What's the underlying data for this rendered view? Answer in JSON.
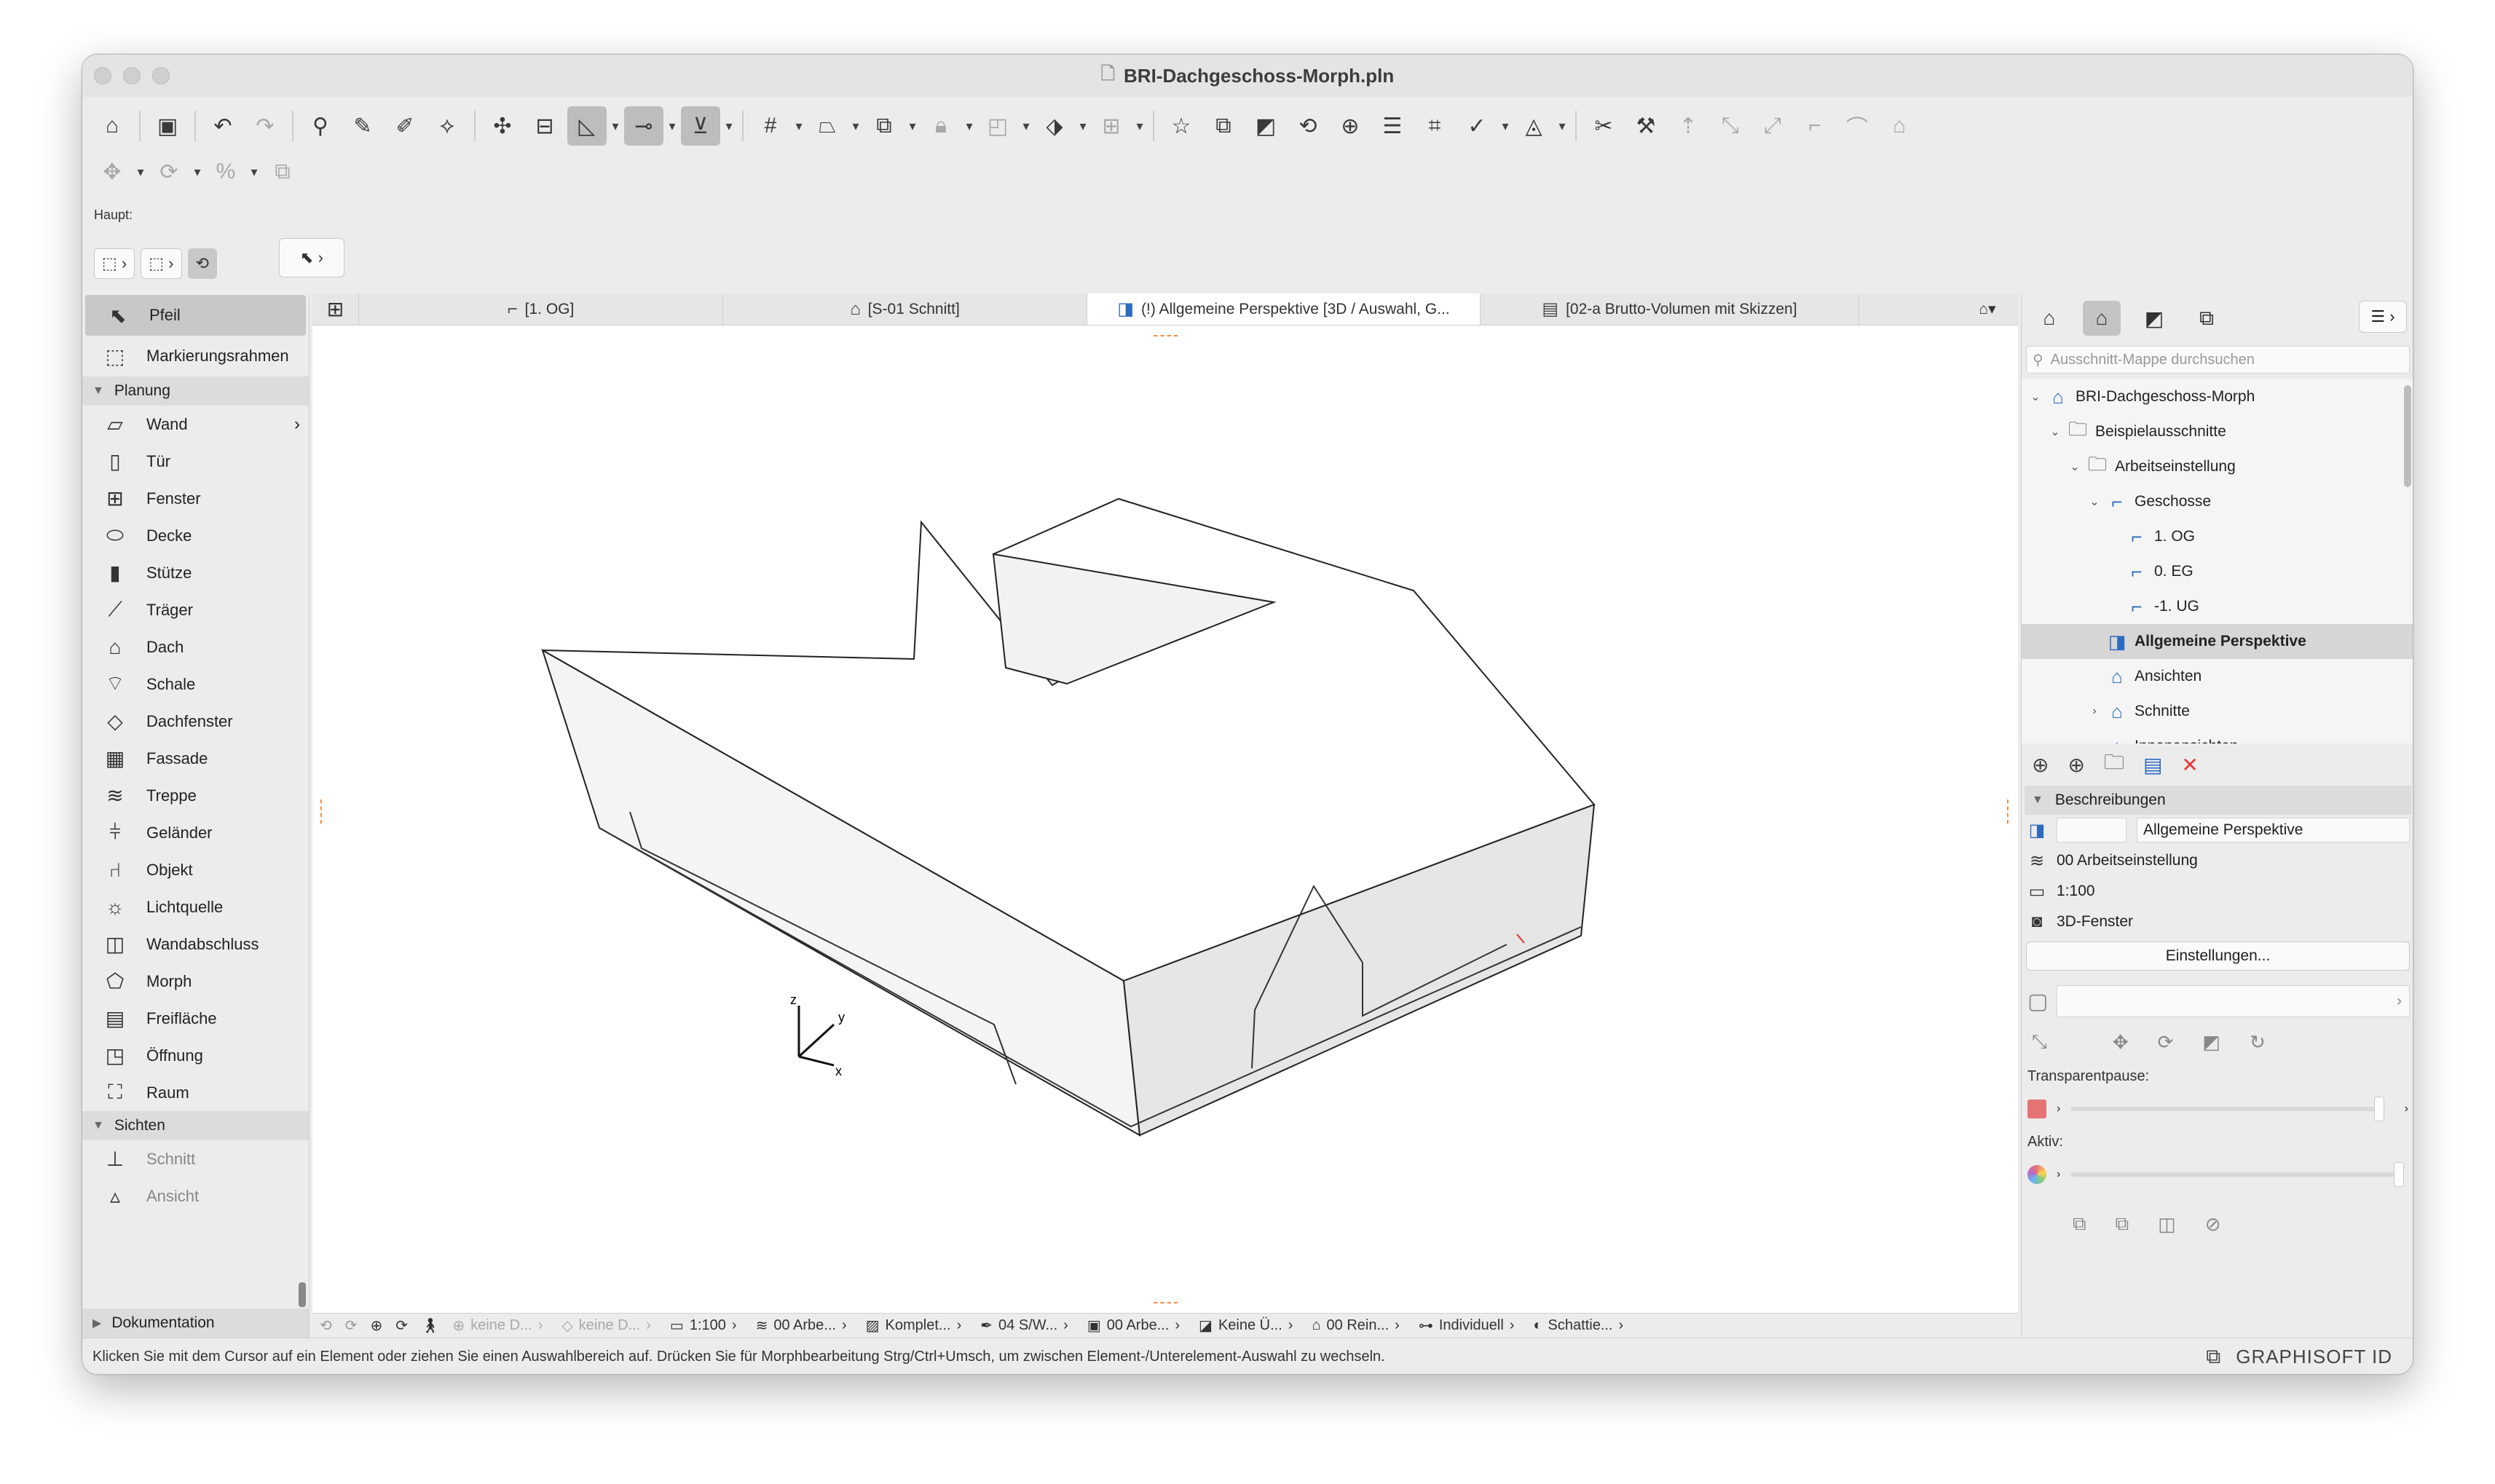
{
  "window": {
    "title": "BRI-Dachgeschoss-Morph.pln"
  },
  "toolbar": {
    "haupt_label": "Haupt:"
  },
  "toolbox": {
    "items_top": [
      {
        "label": "Pfeil",
        "icon": "arrow-pointer-icon",
        "glyph": "⬉",
        "active": true
      },
      {
        "label": "Markierungsrahmen",
        "icon": "marquee-icon",
        "glyph": "⬚"
      }
    ],
    "section_planung": "Planung",
    "planung_items": [
      {
        "label": "Wand",
        "icon": "wall-icon",
        "glyph": "▱",
        "arrow": true
      },
      {
        "label": "Tür",
        "icon": "door-icon",
        "glyph": "▯"
      },
      {
        "label": "Fenster",
        "icon": "window-icon",
        "glyph": "⊞"
      },
      {
        "label": "Decke",
        "icon": "slab-icon",
        "glyph": "⬭"
      },
      {
        "label": "Stütze",
        "icon": "column-icon",
        "glyph": "▮"
      },
      {
        "label": "Träger",
        "icon": "beam-icon",
        "glyph": "⟋"
      },
      {
        "label": "Dach",
        "icon": "roof-icon",
        "glyph": "⌂"
      },
      {
        "label": "Schale",
        "icon": "shell-icon",
        "glyph": "⌔"
      },
      {
        "label": "Dachfenster",
        "icon": "skylight-icon",
        "glyph": "◇"
      },
      {
        "label": "Fassade",
        "icon": "curtain-wall-icon",
        "glyph": "▦"
      },
      {
        "label": "Treppe",
        "icon": "stair-icon",
        "glyph": "≋"
      },
      {
        "label": "Geländer",
        "icon": "railing-icon",
        "glyph": "⫩"
      },
      {
        "label": "Objekt",
        "icon": "object-chair-icon",
        "glyph": "⑁"
      },
      {
        "label": "Lichtquelle",
        "icon": "lamp-icon",
        "glyph": "☼"
      },
      {
        "label": "Wandabschluss",
        "icon": "wall-end-icon",
        "glyph": "◫"
      },
      {
        "label": "Morph",
        "icon": "morph-icon",
        "glyph": "⬠"
      },
      {
        "label": "Freifläche",
        "icon": "mesh-icon",
        "glyph": "▤"
      },
      {
        "label": "Öffnung",
        "icon": "opening-icon",
        "glyph": "◳"
      },
      {
        "label": "Raum",
        "icon": "zone-icon",
        "glyph": "⛶"
      }
    ],
    "section_sichten": "Sichten",
    "sichten_items": [
      {
        "label": "Schnitt",
        "icon": "section-icon",
        "glyph": "⊥"
      },
      {
        "label": "Ansicht",
        "icon": "elevation-icon",
        "glyph": "▵"
      }
    ],
    "section_dokumentation": "Dokumentation"
  },
  "tabs": [
    {
      "label": "[1. OG]",
      "icon": "floor-plan-icon",
      "glyph": "⌐"
    },
    {
      "label": "[S-01 Schnitt]",
      "icon": "section-tab-icon",
      "glyph": "⌂"
    },
    {
      "label": "(!) Allgemeine Perspektive [3D / Auswahl, G...",
      "icon": "3d-view-icon",
      "glyph": "◨",
      "active": true
    },
    {
      "label": "[02-a Brutto-Volumen mit Skizzen]",
      "icon": "worksheet-icon",
      "glyph": "▤"
    }
  ],
  "navigator": {
    "search_placeholder": "Ausschnitt-Mappe durchsuchen",
    "tree": [
      {
        "label": "BRI-Dachgeschoss-Morph",
        "depth": 0,
        "toggle": "⌄",
        "icon": "project-icon",
        "glyph": "⌂"
      },
      {
        "label": "Beispielausschnitte",
        "depth": 1,
        "toggle": "⌄",
        "icon": "folder-icon",
        "glyph": "🗀"
      },
      {
        "label": "Arbeitseinstellung",
        "depth": 2,
        "toggle": "⌄",
        "icon": "folder-icon",
        "glyph": "🗀"
      },
      {
        "label": "Geschosse",
        "depth": 3,
        "toggle": "⌄",
        "icon": "stories-icon",
        "glyph": "⌐"
      },
      {
        "label": "1. OG",
        "depth": 4,
        "toggle": "",
        "icon": "story-icon",
        "glyph": "⌐"
      },
      {
        "label": "0. EG",
        "depth": 4,
        "toggle": "",
        "icon": "story-icon",
        "glyph": "⌐"
      },
      {
        "label": "-1. UG",
        "depth": 4,
        "toggle": "",
        "icon": "story-icon",
        "glyph": "⌐"
      },
      {
        "label": "Allgemeine Perspektive",
        "depth": 3,
        "toggle": "",
        "icon": "3d-view-icon",
        "glyph": "◨",
        "selected": true
      },
      {
        "label": "Ansichten",
        "depth": 3,
        "toggle": "",
        "icon": "elevations-icon",
        "glyph": "⌂"
      },
      {
        "label": "Schnitte",
        "depth": 3,
        "toggle": "›",
        "icon": "sections-icon",
        "glyph": "⌂"
      },
      {
        "label": "Innenansichten",
        "depth": 3,
        "toggle": "",
        "icon": "interior-icon",
        "glyph": "⌂"
      }
    ],
    "section_beschreibungen": "Beschreibungen",
    "view_id_value": "",
    "view_name_value": "Allgemeine Perspektive",
    "layer_combo": "00 Arbeitseinstellung",
    "scale": "1:100",
    "window_type": "3D-Fenster",
    "settings_button": "Einstellungen...",
    "transparent_label": "Transparentpause:",
    "aktiv_label": "Aktiv:",
    "transparent_color": "#e57373"
  },
  "bottombar": [
    {
      "label": "keine D...",
      "icon": "zoom-icon",
      "dim": true
    },
    {
      "label": "keine D...",
      "icon": "markup-icon",
      "dim": true
    },
    {
      "label": "1:100",
      "icon": "scale-icon"
    },
    {
      "label": "00 Arbe...",
      "icon": "layers-icon"
    },
    {
      "label": "Komplet...",
      "icon": "structure-icon"
    },
    {
      "label": "04 S/W...",
      "icon": "pen-set-icon"
    },
    {
      "label": "00 Arbe...",
      "icon": "model-view-icon"
    },
    {
      "label": "Keine Ü...",
      "icon": "override-icon"
    },
    {
      "label": "00 Rein...",
      "icon": "renovation-icon"
    },
    {
      "label": "Individuell",
      "icon": "dimension-icon"
    },
    {
      "label": "Schattie...",
      "icon": "shading-icon"
    }
  ],
  "status": {
    "message": "Klicken Sie mit dem Cursor auf ein Element oder ziehen Sie einen Auswahlbereich auf. Drücken Sie für Morphbearbeitung Strg/Ctrl+Umsch, um zwischen Element-/Unterelement-Auswahl zu wechseln.",
    "brand": "GRAPHISOFT ID"
  },
  "axes": {
    "z": "z",
    "y": "y",
    "x": "x"
  }
}
